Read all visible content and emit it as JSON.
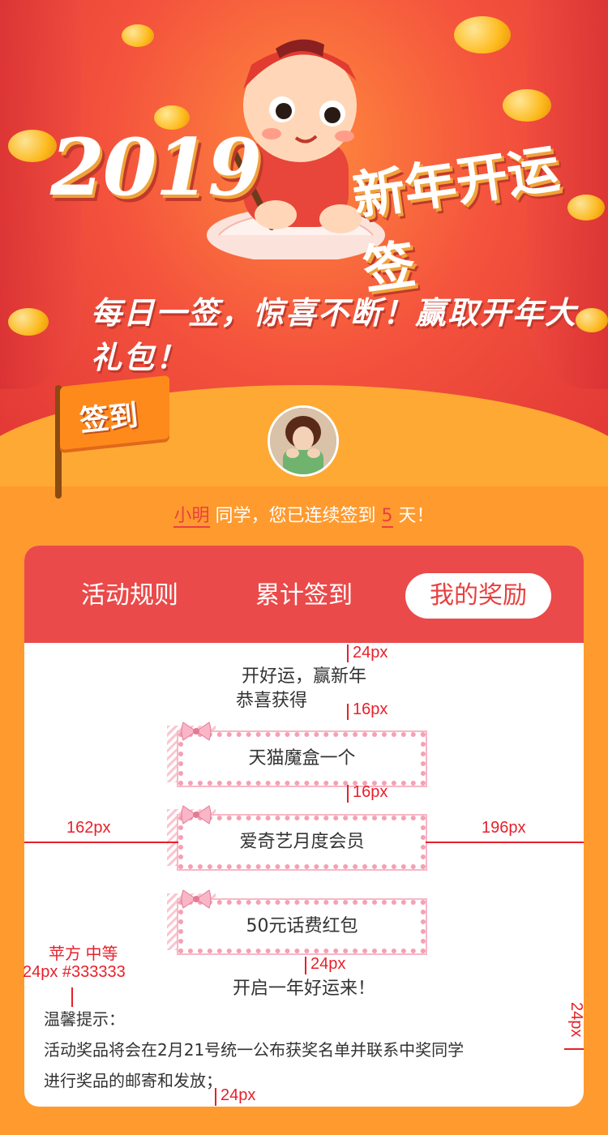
{
  "hero": {
    "year": "2019",
    "title": "新年开运签",
    "slogan": "每日一签，惊喜不断！赢取开年大礼包！"
  },
  "flag": {
    "label": "签到"
  },
  "greeting": {
    "name": "小明",
    "middle": " 同学，您已连续签到 ",
    "days": "5",
    "suffix": " 天！"
  },
  "tabs": [
    {
      "label": "活动规则",
      "active": false
    },
    {
      "label": "累计签到",
      "active": false
    },
    {
      "label": "我的奖励",
      "active": true
    }
  ],
  "rewards": {
    "intro_line1": "开好运，赢新年",
    "intro_line2": "恭喜获得",
    "prizes": [
      "天猫魔盒一个",
      "爱奇艺月度会员",
      "50元话费红包"
    ],
    "outro": "开启一年好运来！"
  },
  "tips": {
    "title": "温馨提示：",
    "line1": "活动奖品将会在2月21号统一公布获奖名单并联系中奖同学",
    "line2": "进行奖品的邮寄和发放；"
  },
  "annotations": {
    "top_gap": "24px",
    "gap1": "16px",
    "gap2": "16px",
    "left_margin": "162px",
    "right_margin": "196px",
    "font_spec_line1": "苹方 中等",
    "font_spec_line2": "24px #333333",
    "gap3": "24px",
    "right_pad": "24px",
    "bottom_gap": "24px"
  },
  "colors": {
    "primary_red": "#ea4a4a",
    "accent_orange": "#ff9a2e",
    "text": "#333333",
    "annotation": "#e8202a"
  }
}
